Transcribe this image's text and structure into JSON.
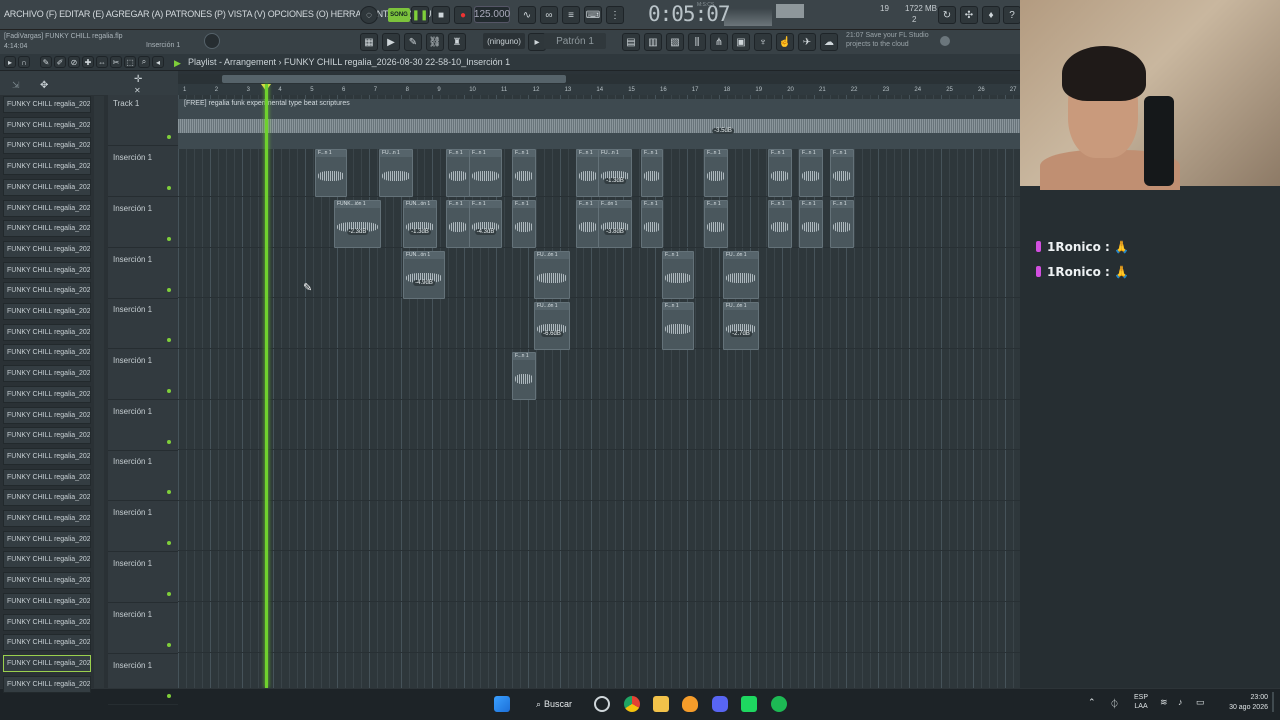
{
  "menubar": {
    "menus": "ARCHIVO (F)  EDITAR (E)  AGREGAR (A)  PATRONES (P)  VISTA (V)  OPCIONES (O)  HERRAMIENTAS (T)  AYUDA",
    "song_mode": "SONG",
    "tempo": "125.000",
    "time": "0:05:07",
    "time_unit": "M:S:CS",
    "ram": "19",
    "ram_mb": "1722 MB",
    "polyphony": "2"
  },
  "toolbar": {
    "project_file": "[FadiVargas] FUNKY CHILL regalia.flp",
    "project_time": "4:14:04",
    "insert_name": "Inserción 1",
    "pattern_none": "(ninguno)",
    "pattern": "Patrón 1",
    "hint": "21:07  Save your FL Studio projects to the cloud"
  },
  "playlist": {
    "title": "Playlist - Arrangement › FUNKY CHILL regalia_2026-08-30 22-58-10_Inserción 1",
    "audio_clip_name": "[FREE] regalia  funk  experimental type beat  scriptures",
    "audio_clip_db": "-3.5dB",
    "ruler": [
      "1",
      "2",
      "3",
      "4",
      "5",
      "6",
      "7",
      "8",
      "9",
      "10",
      "11",
      "12",
      "13",
      "14",
      "15",
      "16",
      "17",
      "18",
      "19",
      "20",
      "21",
      "22",
      "23",
      "24",
      "25",
      "26",
      "27"
    ],
    "tracks": [
      "Track 1",
      "Inserción 1",
      "Inserción 1",
      "Inserción 1",
      "Inserción 1",
      "Inserción 1",
      "Inserción 1",
      "Inserción 1",
      "Inserción 1",
      "Inserción 1",
      "Inserción 1",
      "Inserción 1"
    ]
  },
  "browser": {
    "items": [
      "FUNKY CHILL regalia_202...",
      "FUNKY CHILL regalia_202...",
      "FUNKY CHILL regalia_202...",
      "FUNKY CHILL regalia_202...",
      "FUNKY CHILL regalia_202...",
      "FUNKY CHILL regalia_202...",
      "FUNKY CHILL regalia_202...",
      "FUNKY CHILL regalia_202...",
      "FUNKY CHILL regalia_202...",
      "FUNKY CHILL regalia_202...",
      "FUNKY CHILL regalia_202...",
      "FUNKY CHILL regalia_202...",
      "FUNKY CHILL regalia_202...",
      "FUNKY CHILL regalia_202...",
      "FUNKY CHILL regalia_202...",
      "FUNKY CHILL regalia_202...",
      "FUNKY CHILL regalia_202...",
      "FUNKY CHILL regalia_202...",
      "FUNKY CHILL regalia_202...",
      "FUNKY CHILL regalia_202...",
      "FUNKY CHILL regalia_202...",
      "FUNKY CHILL regalia_202...",
      "FUNKY CHILL regalia_202...",
      "FUNKY CHILL regalia_202...",
      "FUNKY CHILL regalia_202...",
      "FUNKY CHILL regalia_202...",
      "FUNKY CHILL regalia_202...",
      "FUNKY CHILL regalia_202...",
      "FUNKY CHILL regalia_202..."
    ],
    "selected_index": 27
  },
  "clips": {
    "labels": [
      "F...n 1",
      "FU...n 1",
      "FUNK...ión 1",
      "FUN...ón 1",
      "FU...ón 1",
      "F...ón 1",
      "F...n 1"
    ],
    "db": [
      "-1.3dB",
      "-2.3dB",
      "-1.3dB",
      "-4.3dB",
      "-3.8dB",
      "-4.9dB",
      "-6.6dB",
      "-2.7dB"
    ]
  },
  "chat": {
    "messages": [
      {
        "user": "1Ronico :",
        "text": ""
      },
      {
        "user": "1Ronico :",
        "text": ""
      }
    ]
  },
  "taskbar": {
    "search": "Buscar",
    "lang": "ESP",
    "layout": "LAA",
    "time": "23:00",
    "date": "30 ago 2026"
  },
  "colors": {
    "playhead": "#6fd12e",
    "chat_pip": "#d24fe0"
  }
}
